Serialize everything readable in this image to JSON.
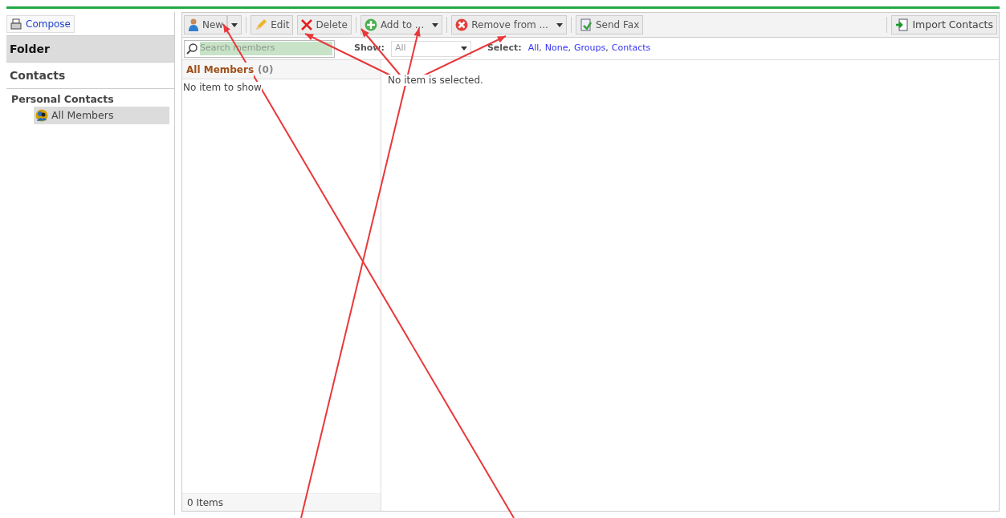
{
  "sidebar": {
    "compose": "Compose",
    "sections": [
      {
        "title": "Folder",
        "selected": true
      },
      {
        "title": "Contacts",
        "selected": false
      }
    ],
    "tree": {
      "label": "Personal Contacts",
      "children": [
        {
          "label": "All Members",
          "selected": true
        }
      ]
    }
  },
  "toolbar": {
    "buttons": [
      {
        "kind": "split",
        "label": "New"
      },
      {
        "kind": "plain",
        "label": "Edit"
      },
      {
        "kind": "plain",
        "label": "Delete"
      },
      {
        "kind": "menu",
        "label": "Add to ..."
      },
      {
        "kind": "menu",
        "label": "Remove from ..."
      },
      {
        "kind": "plain",
        "label": "Send Fax"
      }
    ],
    "right_button": "Import Contacts"
  },
  "filter": {
    "search_placeholder": "Search members",
    "show_label": "Show:",
    "show_value": "All",
    "select_label": "Select:",
    "select_links": [
      "All",
      "None",
      "Groups",
      "Contacts"
    ],
    "separator": ","
  },
  "list": {
    "title": "All Members",
    "count": "(0)",
    "empty": "No item to show",
    "footer": "0 Items"
  },
  "detail": {
    "empty": "No item is selected."
  }
}
